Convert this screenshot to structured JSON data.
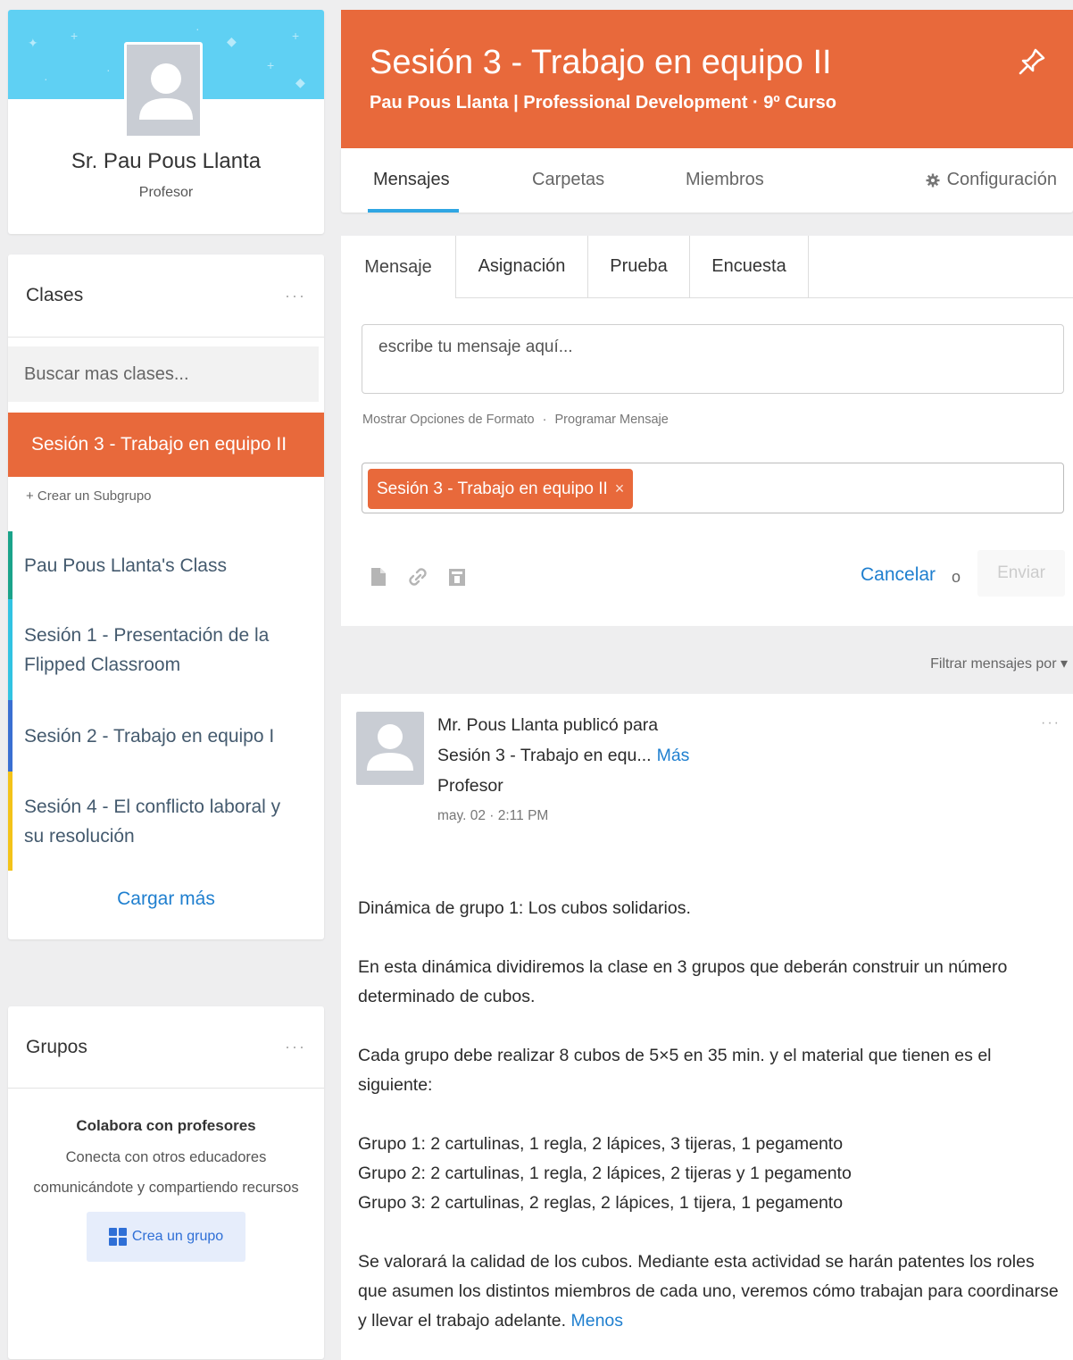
{
  "profile": {
    "name": "Sr. Pau Pous Llanta",
    "role": "Profesor"
  },
  "classes": {
    "title": "Clases",
    "more_icon": "more-dots-icon",
    "search_placeholder": "Buscar mas clases...",
    "active": "Sesión 3 - Trabajo en equipo II",
    "create_subgroup": "+ Crear un Subgrupo",
    "items": [
      {
        "line1": "Pau Pous Llanta's Class",
        "line2": "",
        "color": "#1aa38a"
      },
      {
        "line1": "Sesión 1 - Presentación de la",
        "line2": "Flipped Classroom",
        "color": "#31c3e2"
      },
      {
        "line1": "Sesión 2 - Trabajo en equipo I",
        "line2": "",
        "color": "#3a6fd2"
      },
      {
        "line1": "Sesión 4 - El conflicto laboral y",
        "line2": "su resolución",
        "color": "#f3c319"
      }
    ],
    "load_more": "Cargar más"
  },
  "groups": {
    "title": "Grupos",
    "collab_title": "Colabora con profesores",
    "collab_desc": "Conecta con otros educadores comunicándote y compartiendo recursos",
    "create_button": "Crea un grupo"
  },
  "header": {
    "title": "Sesión 3 - Trabajo en equipo II",
    "subtitle": "Pau Pous Llanta | Professional Development · 9º Curso",
    "accent": "#e8693b"
  },
  "tabs": {
    "items": [
      "Mensajes",
      "Carpetas",
      "Miembros"
    ],
    "config": "Configuración"
  },
  "composer": {
    "tabs": [
      "Mensaje",
      "Asignación",
      "Prueba",
      "Encuesta"
    ],
    "placeholder": "escribe tu mensaje aquí...",
    "format_link": "Mostrar Opciones de Formato",
    "separator": "·",
    "schedule_link": "Programar Mensaje",
    "recipient_chip": "Sesión 3 - Trabajo en equipo II",
    "chip_close": "×",
    "cancel": "Cancelar",
    "or": "o",
    "send": "Enviar"
  },
  "filter": "Filtrar mensajes por ▾",
  "post": {
    "author_line": "Mr. Pous Llanta publicó para",
    "target": "Sesión 3 - Trabajo en equ...",
    "more": "Más",
    "role": "Profesor",
    "date": "may. 02 · 2:11 PM",
    "p1": "Dinámica de grupo 1: Los cubos solidarios.",
    "p2": "En esta dinámica dividiremos la clase en 3 grupos que deberán construir un número determinado de cubos.",
    "p3": "Cada grupo debe realizar 8 cubos de 5×5 en 35 min. y el material que tienen es el siguiente:",
    "g1": "Grupo 1: 2 cartulinas, 1 regla, 2 lápices, 3 tijeras, 1 pegamento",
    "g2": "Grupo 2: 2 cartulinas, 1 regla, 2 lápices, 2 tijeras y 1 pegamento",
    "g3": "Grupo 3: 2 cartulinas, 2 reglas, 2 lápices, 1 tijera, 1 pegamento",
    "p4": "Se valorará la calidad de los cubos. Mediante esta actividad se harán patentes los roles que asumen los distintos miembros de cada uno, veremos cómo trabajan para coordinarse y llevar el trabajo adelante.",
    "less": "Menos"
  }
}
